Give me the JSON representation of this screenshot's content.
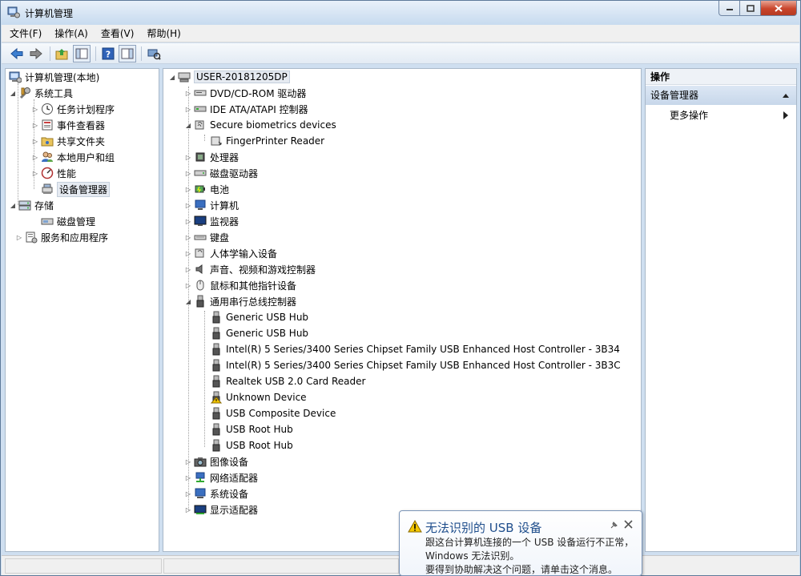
{
  "window": {
    "title": "计算机管理"
  },
  "menu": [
    "文件(F)",
    "操作(A)",
    "查看(V)",
    "帮助(H)"
  ],
  "left_tree": {
    "root": "计算机管理(本地)",
    "system_tools": "系统工具",
    "items": [
      "任务计划程序",
      "事件查看器",
      "共享文件夹",
      "本地用户和组",
      "性能",
      "设备管理器"
    ],
    "storage": "存储",
    "disk_mgmt": "磁盘管理",
    "services": "服务和应用程序"
  },
  "device_tree": {
    "root": "USER-20181205DP",
    "dvd": "DVD/CD-ROM 驱动器",
    "ide": "IDE ATA/ATAPI 控制器",
    "biometrics": "Secure biometrics devices",
    "fingerprinter": "FingerPrinter Reader",
    "processor": "处理器",
    "disk_drives": "磁盘驱动器",
    "battery": "电池",
    "computer": "计算机",
    "monitors": "监视器",
    "keyboard": "键盘",
    "hid": "人体学输入设备",
    "sound": "声音、视频和游戏控制器",
    "mouse": "鼠标和其他指针设备",
    "usb_controllers": "通用串行总线控制器",
    "usb_children": [
      "Generic USB Hub",
      "Generic USB Hub",
      "Intel(R) 5 Series/3400 Series Chipset Family USB Enhanced Host Controller - 3B34",
      "Intel(R) 5 Series/3400 Series Chipset Family USB Enhanced Host Controller - 3B3C",
      "Realtek USB 2.0 Card Reader",
      "Unknown Device",
      "USB Composite Device",
      "USB Root Hub",
      "USB Root Hub"
    ],
    "imaging": "图像设备",
    "network": "网络适配器",
    "system_devices": "系统设备",
    "display": "显示适配器"
  },
  "actions": {
    "header": "操作",
    "section": "设备管理器",
    "more": "更多操作"
  },
  "balloon": {
    "title": "无法识别的 USB 设备",
    "line1": "跟这台计算机连接的一个 USB 设备运行不正常，",
    "line2": "Windows 无法识别。",
    "line3": "要得到协助解决这个问题，请单击这个消息。"
  }
}
